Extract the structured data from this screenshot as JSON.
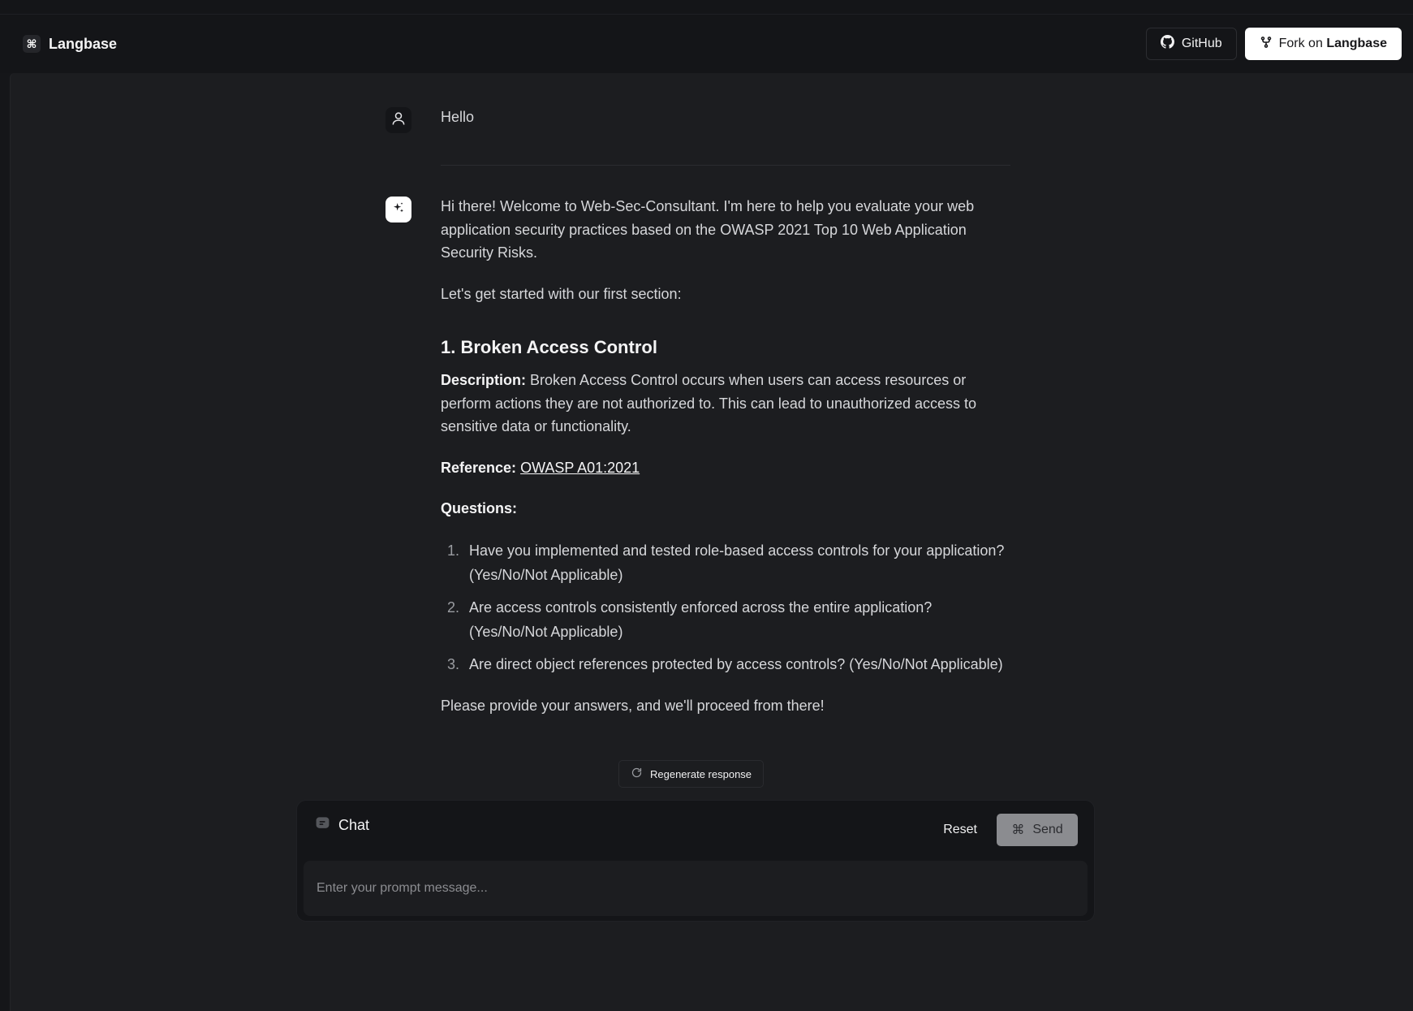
{
  "header": {
    "brand_icon": "⌘",
    "brand_name": "Langbase",
    "github_label": "GitHub",
    "fork_prefix": "Fork on",
    "fork_brand": "Langbase"
  },
  "conversation": {
    "user_message": "Hello",
    "assistant": {
      "intro": "Hi there! Welcome to Web-Sec-Consultant. I'm here to help you evaluate your web application security practices based on the OWASP 2021 Top 10 Web Application Security Risks.",
      "lead": "Let's get started with our first section:",
      "section_title": "1. Broken Access Control",
      "description_label": "Description:",
      "description_text": " Broken Access Control occurs when users can access resources or perform actions they are not authorized to. This can lead to unauthorized access to sensitive data or functionality.",
      "reference_label": "Reference:",
      "reference_link": "OWASP A01:2021",
      "questions_label": "Questions:",
      "questions": [
        {
          "num": "1.",
          "text": "Have you implemented and tested role-based access controls for your application? (Yes/No/Not Applicable)"
        },
        {
          "num": "2.",
          "text": "Are access controls consistently enforced across the entire application? (Yes/No/Not Applicable)"
        },
        {
          "num": "3.",
          "text": "Are direct object references protected by access controls? (Yes/No/Not Applicable)"
        }
      ],
      "closing": "Please provide your answers, and we'll proceed from there!"
    }
  },
  "regenerate_label": "Regenerate response",
  "chat": {
    "title": "Chat",
    "reset_label": "Reset",
    "send_icon": "⌘",
    "send_label": "Send",
    "input_placeholder": "Enter your prompt message..."
  },
  "colors": {
    "background": "#1c1d20",
    "header": "#141518",
    "primary_button": "#ffffff",
    "send_button_disabled": "#8b8c90"
  },
  "icons": {
    "brand": "command-icon",
    "github": "github-icon",
    "fork": "git-fork-icon",
    "user": "user-icon",
    "assistant": "sparkles-icon",
    "regenerate": "refresh-icon",
    "chat": "message-icon",
    "send": "command-icon"
  }
}
